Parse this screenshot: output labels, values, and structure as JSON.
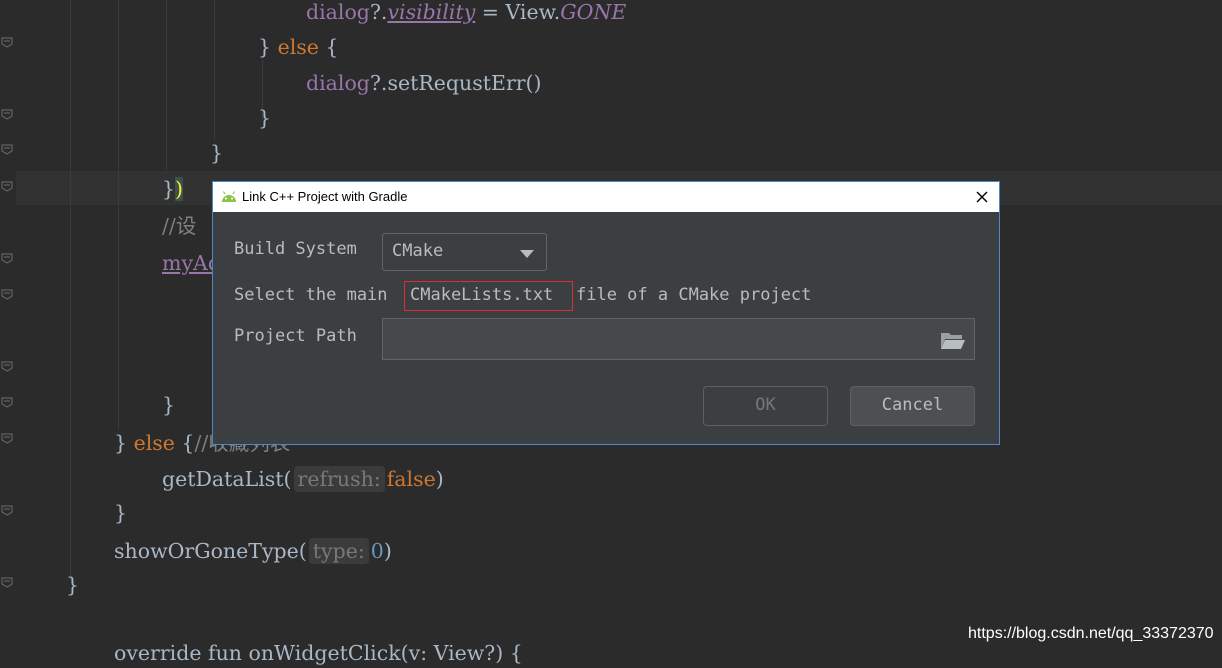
{
  "editor": {
    "lines": [
      {
        "tokens": [
          {
            "t": "dialog",
            "c": "pv"
          },
          {
            "t": "?.",
            "c": ""
          },
          {
            "t": "visibility",
            "c": "pi"
          },
          {
            "t": " = View.",
            "c": ""
          },
          {
            "t": "GONE",
            "c": "ci"
          }
        ]
      },
      {
        "tokens": [
          {
            "t": "} ",
            "c": ""
          },
          {
            "t": "else",
            "c": "kw"
          },
          {
            "t": " {",
            "c": ""
          }
        ]
      },
      {
        "tokens": [
          {
            "t": "dialog",
            "c": "pv"
          },
          {
            "t": "?.setRequstErr()",
            "c": ""
          }
        ]
      },
      {
        "tokens": [
          {
            "t": "}",
            "c": ""
          }
        ]
      },
      {
        "tokens": [
          {
            "t": "}",
            "c": ""
          }
        ]
      },
      {
        "tokens": [
          {
            "t": "}",
            "c": ""
          },
          {
            "t": ")",
            "c": "bracehl"
          }
        ]
      },
      {
        "tokens": [
          {
            "t": "//设",
            "c": "cm"
          }
        ]
      },
      {
        "tokens": [
          {
            "t": "myAd",
            "c": "pv ul"
          }
        ]
      },
      {
        "tokens": [
          {
            "t": "}",
            "c": ""
          }
        ]
      },
      {
        "tokens": [
          {
            "t": "} ",
            "c": ""
          },
          {
            "t": "else",
            "c": "kw"
          },
          {
            "t": " {",
            "c": ""
          },
          {
            "t": "//收藏列表",
            "c": "cm"
          }
        ]
      },
      {
        "tokens": [
          {
            "t": "getDataList(",
            "c": ""
          },
          {
            "t": "refrush:",
            "c": "hint"
          },
          {
            "t": "false",
            "c": "kw"
          },
          {
            "t": ")",
            "c": ""
          }
        ]
      },
      {
        "tokens": [
          {
            "t": "}",
            "c": ""
          }
        ]
      },
      {
        "tokens": [
          {
            "t": "showOrGoneType(",
            "c": ""
          },
          {
            "t": "type:",
            "c": "hint"
          },
          {
            "t": "0",
            "c": "num"
          },
          {
            "t": ")",
            "c": ""
          }
        ]
      },
      {
        "tokens": [
          {
            "t": "}",
            "c": ""
          }
        ]
      },
      {
        "tokens": [
          {
            "t": "override fun onWidgetClick(v: View?) {",
            "c": ""
          }
        ]
      }
    ]
  },
  "dialog": {
    "title": "Link C++ Project with Gradle",
    "build_system_label": "Build System",
    "build_system_value": "CMake",
    "instruction_prefix": "Select the main",
    "instruction_file": "CMakeLists.txt",
    "instruction_suffix": "file of a CMake project",
    "project_path_label": "Project Path",
    "project_path_value": "",
    "ok_label": "OK",
    "cancel_label": "Cancel",
    "close_icon": "close-icon",
    "browse_icon": "folder-icon"
  },
  "watermark": "https://blog.csdn.net/qq_33372370",
  "colors": {
    "background": "#2b2b2b",
    "keyword": "#cc7832",
    "property": "#9876aa",
    "text": "#a9b7c6",
    "comment": "#808080",
    "number": "#6897bb",
    "dialog_bg": "#3c3f41",
    "highlight_box": "#e02d2d"
  }
}
